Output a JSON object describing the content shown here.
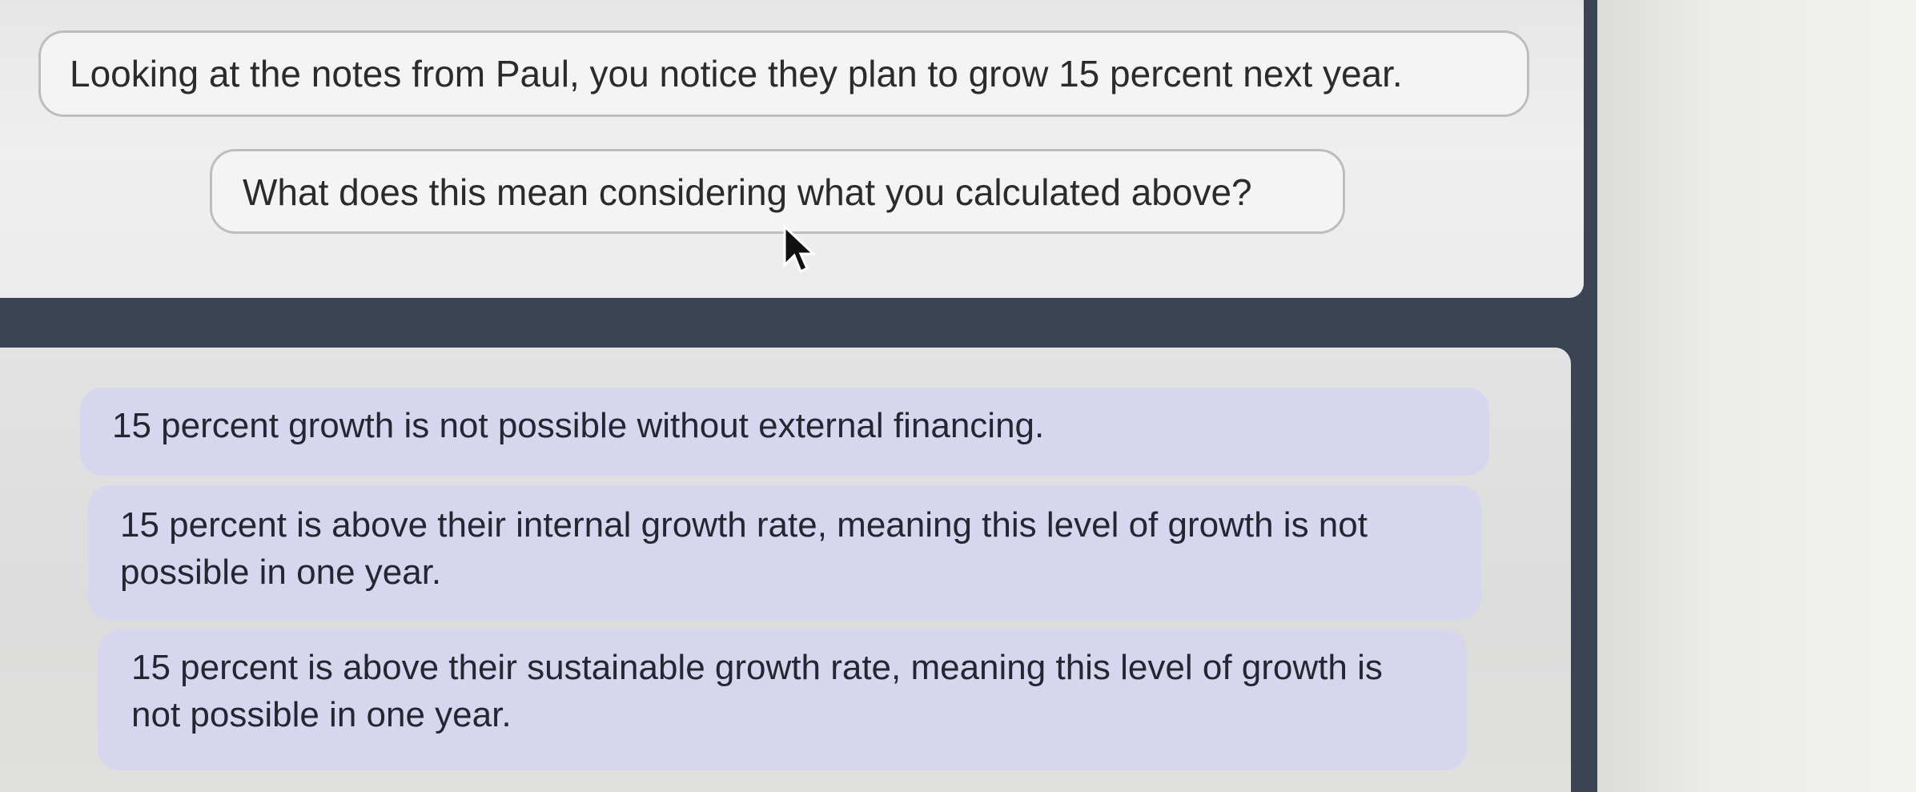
{
  "question": {
    "prompt": "Looking at the notes from Paul, you notice they plan to grow 15 percent next year.",
    "sub_prompt": "What does this mean considering what you calculated above?"
  },
  "options": [
    {
      "label": "15 percent growth is not possible without external financing."
    },
    {
      "label": "15 percent is above their internal growth rate, meaning this level of growth is not possible in one year."
    },
    {
      "label": "15 percent is above their sustainable growth rate, meaning this level of growth is not possible in one year."
    }
  ],
  "colors": {
    "option_background": "#d6d6ef",
    "frame": "#3a4452",
    "panel": "#e6e6e6"
  },
  "icons": {
    "cursor": "mouse-pointer-icon"
  }
}
